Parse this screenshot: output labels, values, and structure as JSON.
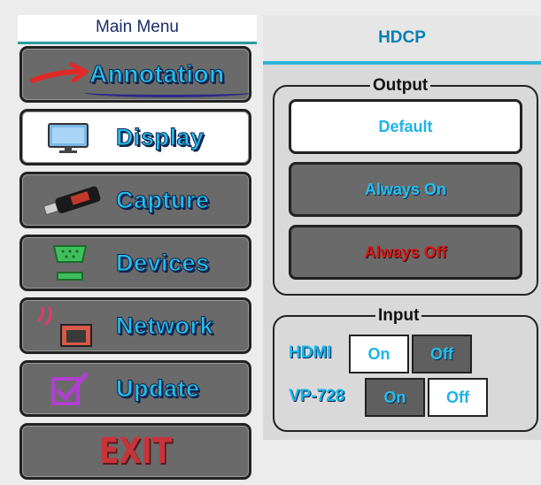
{
  "menu": {
    "title": "Main Menu",
    "items": [
      {
        "label": "Annotation",
        "icon": "red-arrow-icon",
        "active": false
      },
      {
        "label": "Display",
        "icon": "monitor-icon",
        "active": true
      },
      {
        "label": "Capture",
        "icon": "usb-stick-icon",
        "active": false
      },
      {
        "label": "Devices",
        "icon": "serial-port-icon",
        "active": false
      },
      {
        "label": "Network",
        "icon": "network-icon",
        "active": false
      },
      {
        "label": "Update",
        "icon": "checkbox-icon",
        "active": false
      }
    ],
    "exit_label": "EXIT"
  },
  "hdcp": {
    "title": "HDCP",
    "output": {
      "title": "Output",
      "options": [
        "Default",
        "Always On",
        "Always Off"
      ],
      "selected": "Default"
    },
    "input": {
      "title": "Input",
      "rows": [
        {
          "label": "HDMI",
          "on": "On",
          "off": "Off",
          "selected": "On"
        },
        {
          "label": "VP-728",
          "on": "On",
          "off": "Off",
          "selected": "Off"
        }
      ]
    }
  },
  "colors": {
    "accent": "#23c0ee",
    "header_line": "#2cb6d6",
    "exit": "#c8343b",
    "always_off": "#d41a1a"
  }
}
